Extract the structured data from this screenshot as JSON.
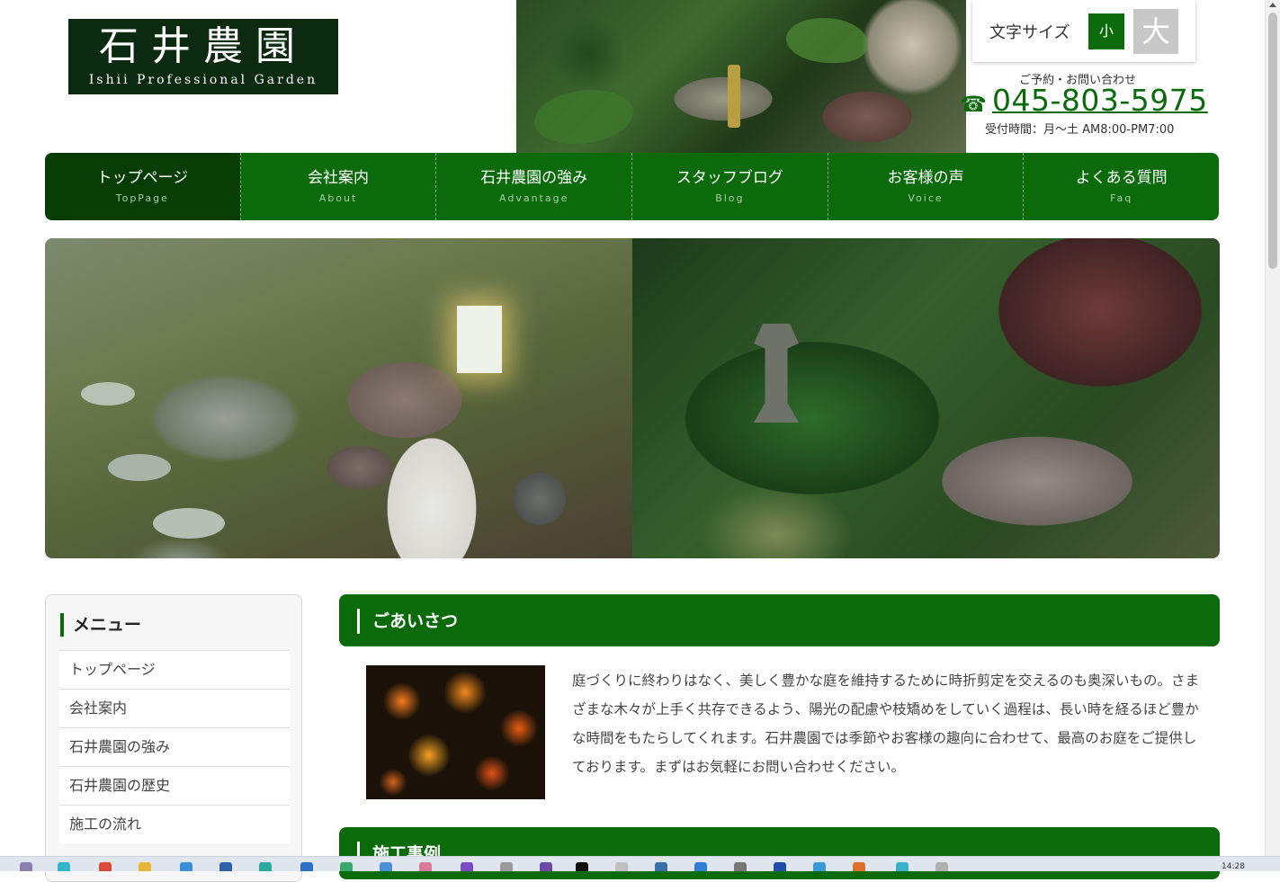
{
  "logo": {
    "main": "石井農園",
    "sub": "Ishii Professional Garden"
  },
  "font_size": {
    "label": "文字サイズ",
    "small": "小",
    "large": "大"
  },
  "contact": {
    "caption": "ご予約・お問い合わせ",
    "phone_icon": "phone-icon",
    "phone": "045-803-5975",
    "hours": "受付時間：月〜土 AM8:00-PM7:00"
  },
  "nav": [
    {
      "jp": "トップページ",
      "en": "TopPage"
    },
    {
      "jp": "会社案内",
      "en": "About"
    },
    {
      "jp": "石井農園の強み",
      "en": "Advantage"
    },
    {
      "jp": "スタッフブログ",
      "en": "Blog"
    },
    {
      "jp": "お客様の声",
      "en": "Voice"
    },
    {
      "jp": "よくある質問",
      "en": "Faq"
    }
  ],
  "sidebar": {
    "title": "メニュー",
    "items": [
      "トップページ",
      "会社案内",
      "石井農園の強み",
      "石井農園の歴史",
      "施工の流れ"
    ]
  },
  "greeting": {
    "title": "ごあいさつ",
    "text": "庭づくりに終わりはなく、美しく豊かな庭を維持するために時折剪定を交えるのも奥深いもの。さまざまな木々が上手く共存できるよう、陽光の配慮や枝矯めをしていく過程は、長い時を経るほど豊かな時間をもたらしてくれます。石井農園では季節やお客様の趣向に合わせて、最高のお庭をご提供しております。まずはお気軽にお問い合わせください。"
  },
  "works": {
    "title": "施工事例"
  },
  "taskbar": {
    "time": "14:28"
  },
  "colors": {
    "brand_green": "#0b6b0b",
    "nav_active": "#053d05",
    "logo_bg": "#0b2a10"
  }
}
